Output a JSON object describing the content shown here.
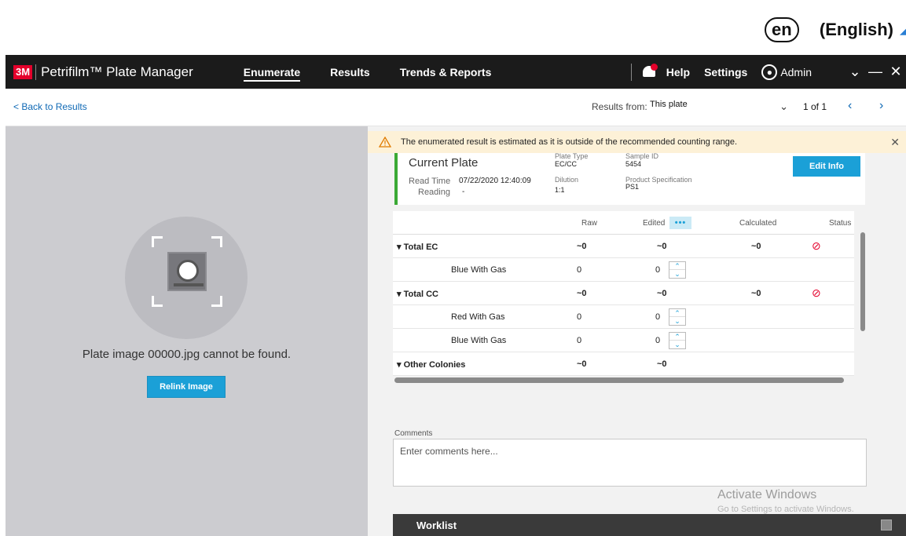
{
  "language": {
    "code": "en",
    "name": "(English)"
  },
  "topbar": {
    "logo": "3M",
    "app_name": "Petrifilm™ Plate Manager",
    "nav": [
      "Enumerate",
      "Results",
      "Trends & Reports"
    ],
    "help": "Help",
    "settings": "Settings",
    "user": "Admin",
    "chevron": "⌄",
    "minimize": "—",
    "close": "✕"
  },
  "subheader": {
    "back_label": "< Back to Results",
    "results_from_label": "Results from:",
    "results_from_value": "This plate",
    "pager": "1 of 1"
  },
  "left": {
    "missing_text": "Plate image 00000.jpg cannot be found.",
    "relink_label": "Relink Image"
  },
  "warning": {
    "text": "The enumerated result is estimated as it is outside of the recommended counting range."
  },
  "plate": {
    "title": "Current Plate",
    "read_time_label": "Read Time",
    "read_time_value": "07/22/2020 12:40:09",
    "reading_label": "Reading",
    "reading_value": "-",
    "plate_type_label": "Plate Type",
    "plate_type_value": "EC/CC",
    "dilution_label": "Dilution",
    "dilution_value": "1:1",
    "sample_id_label": "Sample ID",
    "sample_id_value": "5454",
    "product_spec_label": "Product Specification",
    "product_spec_value": "PS1",
    "edit_info_label": "Edit Info"
  },
  "table": {
    "headers": {
      "raw": "Raw",
      "edited": "Edited",
      "calculated": "Calculated",
      "status": "Status"
    },
    "rows": [
      {
        "name": "Total EC",
        "raw": "~0",
        "edited": "~0",
        "calc": "~0"
      },
      {
        "name": "Blue With Gas",
        "raw": "0",
        "edited": "0"
      },
      {
        "name": "Total CC",
        "raw": "~0",
        "edited": "~0",
        "calc": "~0"
      },
      {
        "name": "Red With Gas",
        "raw": "0",
        "edited": "0"
      },
      {
        "name": "Blue With Gas",
        "raw": "0",
        "edited": "0"
      },
      {
        "name": "Other Colonies",
        "raw": "~0",
        "edited": "~0"
      }
    ]
  },
  "comments": {
    "label": "Comments",
    "placeholder": "Enter comments here..."
  },
  "activate": {
    "title": "Activate Windows",
    "subtitle": "Go to Settings to activate Windows."
  },
  "worklist": {
    "label": "Worklist"
  }
}
